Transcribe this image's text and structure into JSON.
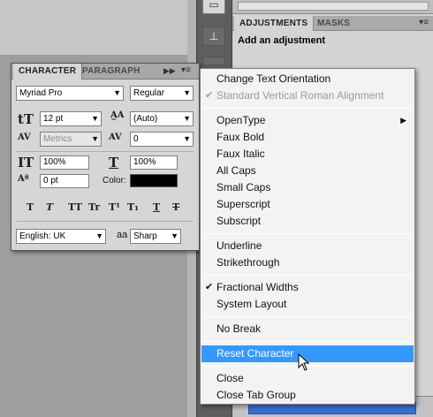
{
  "adjustments_panel": {
    "tabs": [
      "ADJUSTMENTS",
      "MASKS"
    ],
    "heading": "Add an adjustment"
  },
  "character_panel": {
    "tabs": [
      "CHARACTER",
      "PARAGRAPH"
    ],
    "font_family": "Myriad Pro",
    "font_style": "Regular",
    "font_size": "12 pt",
    "leading": "(Auto)",
    "kerning": "Metrics",
    "tracking": "0",
    "vertical_scale": "100%",
    "horizontal_scale": "100%",
    "baseline_shift": "0 pt",
    "color_label": "Color:",
    "color_value": "#000000",
    "language": "English: UK",
    "antialias_label": "aa",
    "antialias": "Sharp",
    "style_buttons": [
      "T",
      "T",
      "TT",
      "Tr",
      "T¹",
      "T₁",
      "T",
      "T"
    ]
  },
  "menu": {
    "items": [
      {
        "label": "Change Text Orientation",
        "enabled": true,
        "checked": false
      },
      {
        "label": "Standard Vertical Roman Alignment",
        "enabled": false,
        "checked": true
      },
      {
        "label": "OpenType",
        "enabled": true,
        "checked": false,
        "submenu": true
      },
      {
        "label": "Faux Bold",
        "enabled": true,
        "checked": false
      },
      {
        "label": "Faux Italic",
        "enabled": true,
        "checked": false
      },
      {
        "label": "All Caps",
        "enabled": true,
        "checked": false
      },
      {
        "label": "Small Caps",
        "enabled": true,
        "checked": false
      },
      {
        "label": "Superscript",
        "enabled": true,
        "checked": false
      },
      {
        "label": "Subscript",
        "enabled": true,
        "checked": false
      },
      {
        "label": "Underline",
        "enabled": true,
        "checked": false
      },
      {
        "label": "Strikethrough",
        "enabled": true,
        "checked": false
      },
      {
        "label": "Fractional Widths",
        "enabled": true,
        "checked": true
      },
      {
        "label": "System Layout",
        "enabled": true,
        "checked": false
      },
      {
        "label": "No Break",
        "enabled": true,
        "checked": false
      },
      {
        "label": "Reset Character",
        "enabled": true,
        "checked": false,
        "selected": true
      },
      {
        "label": "Close",
        "enabled": true,
        "checked": false
      },
      {
        "label": "Close Tab Group",
        "enabled": true,
        "checked": false
      }
    ],
    "check_glyph": "✔",
    "submenu_glyph": "▶"
  },
  "colors": {
    "selection": "#3399ff",
    "menu_bg": "#f3f3f3",
    "panel_bg": "#d6d6d6"
  }
}
